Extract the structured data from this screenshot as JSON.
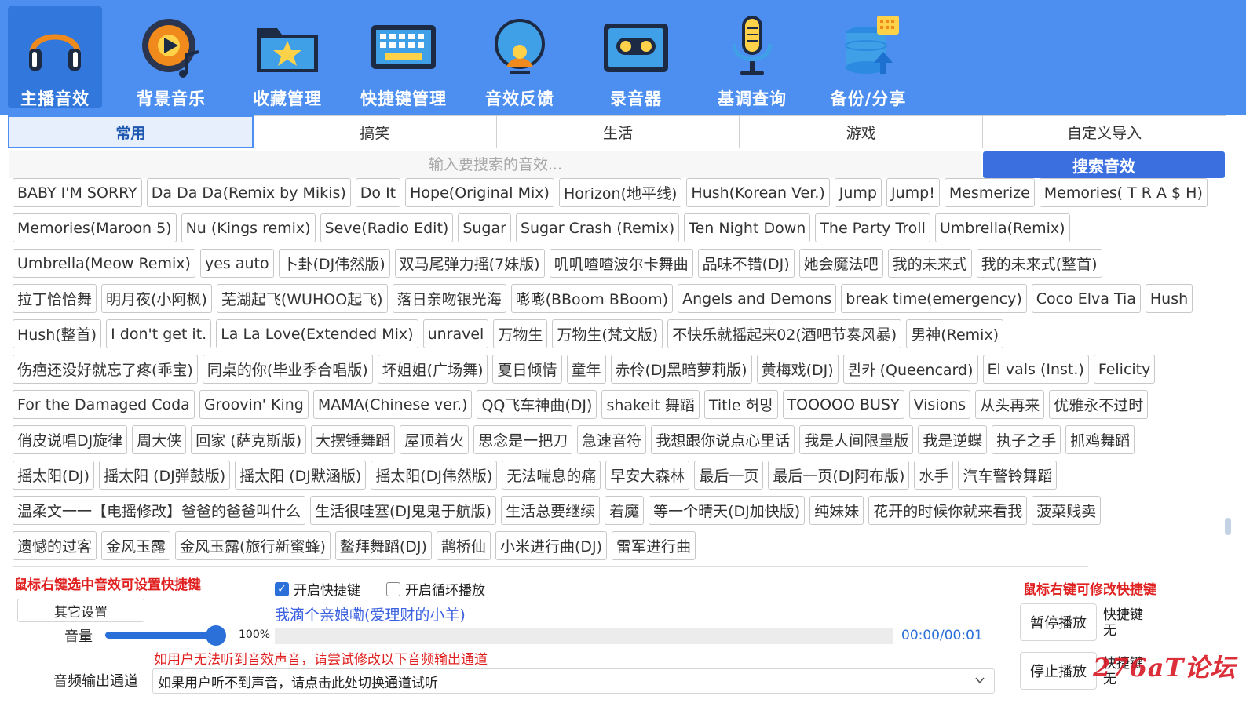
{
  "toolbar": {
    "items": [
      {
        "label": "主播音效",
        "icon": "headphones-icon",
        "active": true
      },
      {
        "label": "背景音乐",
        "icon": "music-disc-icon",
        "active": false
      },
      {
        "label": "收藏管理",
        "icon": "star-folder-icon",
        "active": false
      },
      {
        "label": "快捷键管理",
        "icon": "keyboard-icon",
        "active": false
      },
      {
        "label": "音效反馈",
        "icon": "feedback-bubble-icon",
        "active": false
      },
      {
        "label": "录音器",
        "icon": "cassette-icon",
        "active": false
      },
      {
        "label": "基调查询",
        "icon": "microphone-icon",
        "active": false
      },
      {
        "label": "备份/分享",
        "icon": "database-upload-icon",
        "active": false
      }
    ]
  },
  "tabs": [
    "常用",
    "搞笑",
    "生活",
    "游戏",
    "自定义导入"
  ],
  "active_tab": 0,
  "search": {
    "placeholder": "输入要搜索的音效...",
    "button": "搜索音效"
  },
  "sound_rows": [
    [
      "BABY I'M SORRY",
      "Da Da Da(Remix by Mikis)",
      "Do It",
      "Hope(Original Mix)",
      "Horizon(地平线)",
      "Hush(Korean Ver.)",
      "Jump",
      "Jump!",
      "Mesmerize",
      "Memories( T R A $ H)"
    ],
    [
      "Memories(Maroon 5)",
      "Nu (Kings remix)",
      "Seve(Radio Edit)",
      "Sugar",
      "Sugar Crash (Remix)",
      "Ten Night Down",
      "The Party Troll",
      "Umbrella(Remix)"
    ],
    [
      "Umbrella(Meow Remix)",
      "yes auto",
      "卜卦(DJ伟然版)",
      "双马尾弹力摇(7妹版)",
      "叽叽喳喳波尔卡舞曲",
      "品味不错(DJ)",
      "她会魔法吧",
      "我的未来式",
      "我的未来式(整首)"
    ],
    [
      "拉丁恰恰舞",
      "明月夜(小阿枫)",
      "芜湖起飞(WUHOO起飞)",
      "落日亲吻银光海",
      "嘭嘭(BBoom BBoom)",
      "Angels and Demons",
      "break time(emergency)",
      "Coco Elva Tia",
      "Hush"
    ],
    [
      "Hush(整首)",
      "I don't get it.",
      "La La Love(Extended Mix)",
      "unravel",
      "万物生",
      "万物生(梵文版)",
      "不快乐就摇起来02(酒吧节奏风暴)",
      "男神(Remix)"
    ],
    [
      "伤疤还没好就忘了疼(乖宝)",
      "同桌的你(毕业季合唱版)",
      "坏姐姐(广场舞)",
      "夏日倾情",
      "童年",
      "赤伶(DJ黑暗萝莉版)",
      "黄梅戏(DJ)",
      "퀸카 (Queencard)",
      "El vals (Inst.)",
      "Felicity"
    ],
    [
      "For the Damaged Coda",
      "Groovin' King",
      "MAMA(Chinese ver.)",
      "QQ飞车神曲(DJ)",
      "shakeit 舞蹈",
      "Title 허밍",
      "TOOOOO BUSY",
      "Visions",
      "从头再来",
      "优雅永不过时"
    ],
    [
      "俏皮说唱DJ旋律",
      "周大侠",
      "回家 (萨克斯版)",
      "大摆锤舞蹈",
      "屋顶着火",
      "思念是一把刀",
      "急速音符",
      "我想跟你说点心里话",
      "我是人间限量版",
      "我是逆蝶",
      "执子之手",
      "抓鸡舞蹈"
    ],
    [
      "摇太阳(DJ)",
      "摇太阳 (DJ弹鼓版)",
      "摇太阳 (DJ默涵版)",
      "摇太阳(DJ伟然版)",
      "无法喘息的痛",
      "早安大森林",
      "最后一页",
      "最后一页(DJ阿布版)",
      "水手",
      "汽车警铃舞蹈"
    ],
    [
      "温柔文一一【电摇修改】爸爸的爸爸叫什么",
      "生活很哇塞(DJ鬼鬼于航版)",
      "生活总要继续",
      "着魔",
      "等一个晴天(DJ加快版)",
      "纯妹妹",
      "花开的时候你就来看我",
      "菠菜贱卖"
    ],
    [
      "遗憾的过客",
      "金风玉露",
      "金风玉露(旅行新蜜蜂)",
      "鳌拜舞蹈(DJ)",
      "鹊桥仙",
      "小米进行曲(DJ)",
      "雷军进行曲"
    ]
  ],
  "panel": {
    "hint_left": "鼠标右键选中音效可设置快捷键",
    "hint_right": "鼠标右键可修改快捷键",
    "enable_hotkey": "开启快捷键",
    "enable_hotkey_checked": true,
    "enable_loop": "开启循环播放",
    "enable_loop_checked": false,
    "other_settings": "其它设置",
    "now_playing": "我滴个亲娘嘞(爱理财的小羊)",
    "volume_label": "音量",
    "volume_value": "100%",
    "time": "00:00/00:01",
    "warning": "如用户无法听到音效声音，请尝试修改以下音频输出通道",
    "output_label": "音频输出通道",
    "output_value": "如果用户听不到声音，请点击此处切换通道试听",
    "pause_button": "暂停播放",
    "stop_button": "停止播放",
    "hotkey_label": "快捷键",
    "hotkey_none": "无",
    "watermark": "276aT论坛"
  },
  "colors": {
    "accent": "#4d8ff0",
    "active_tool": "#3278dc",
    "button_blue": "#3b6fe0",
    "warning_red": "#e02020"
  }
}
